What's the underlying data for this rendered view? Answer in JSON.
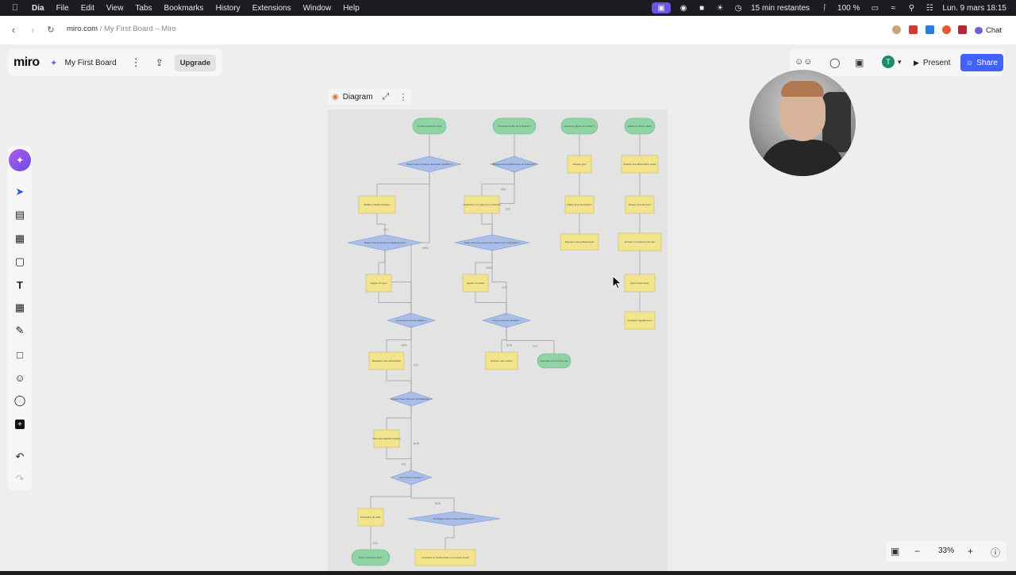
{
  "menubar": {
    "app": "Dia",
    "items": [
      "File",
      "Edit",
      "View",
      "Tabs",
      "Bookmarks",
      "History",
      "Extensions",
      "Window",
      "Help"
    ],
    "timer": "15 min restantes",
    "battery": "100 %",
    "datetime": "Lun. 9 mars  18:15"
  },
  "browser": {
    "url_domain": "miro.com",
    "url_path": " / My First Board – Miro",
    "chat_label": "Chat"
  },
  "miro": {
    "logo": "miro",
    "board_name": "My First Board",
    "upgrade_label": "Upgrade",
    "present_label": "Present",
    "share_label": "Share",
    "avatar_initial": "T",
    "diagram_label": "Diagram",
    "zoom": "33%"
  },
  "flowchart": {
    "nodes": [
      {
        "shape": "terminal",
        "text": "Tu veux perdre du poids"
      },
      {
        "shape": "decision",
        "text": "Suivez-vous un régime alimentaire équilibré ?"
      },
      {
        "shape": "process",
        "text": "Établir un déficit calorique"
      },
      {
        "shape": "decision",
        "text": "Faites-vous de l'exercice régulièrement ?"
      },
      {
        "shape": "process",
        "text": "Intégrer du sport"
      },
      {
        "shape": "decision",
        "text": "Les progrès sont-ils visibles ?"
      },
      {
        "shape": "process",
        "text": "Réajustez votre alimentation"
      },
      {
        "shape": "decision",
        "text": "Pouvez-vous maintenir ces habitudes ?"
      },
      {
        "shape": "process",
        "text": "Fixez des objectifs réalistes"
      },
      {
        "shape": "decision",
        "text": "Avez-vous un soutien ?"
      },
      {
        "shape": "process",
        "text": "Demandez de l'aide"
      },
      {
        "shape": "decision",
        "text": "Envisagez-vous un suivi professionnel ?"
      },
      {
        "shape": "terminal",
        "text": "Bravo, continuez ainsi !"
      },
      {
        "shape": "process",
        "text": "Consultez un nutritionniste ou un coach sportif"
      },
      {
        "shape": "terminal",
        "text": "Comment perdre de la graisse ?"
      },
      {
        "shape": "decision",
        "text": "Mangez-vous suffisamment de protéines ?"
      },
      {
        "shape": "process",
        "text": "Augmentez vos apports en protéines"
      },
      {
        "shape": "decision",
        "text": "Faites-vous des séances de cardio et de musculation ?"
      },
      {
        "shape": "process",
        "text": "Ajoutez du cardio"
      },
      {
        "shape": "decision",
        "text": "Voyez-vous des résultats ?"
      },
      {
        "shape": "process",
        "text": "Révisez votre routine"
      },
      {
        "shape": "terminal",
        "text": "Vous êtes sur la bonne voie"
      },
      {
        "shape": "terminal",
        "text": "Comment gagner du muscle ?"
      },
      {
        "shape": "process",
        "text": "Mangez plus"
      },
      {
        "shape": "process",
        "text": "Faites de la musculation"
      },
      {
        "shape": "process",
        "text": "Reposez-vous suffisamment"
      },
      {
        "shape": "terminal",
        "text": "Rester en bonne santé"
      },
      {
        "shape": "process",
        "text": "Adoptez une alimentation variée"
      },
      {
        "shape": "process",
        "text": "Bougez tous les jours"
      },
      {
        "shape": "process",
        "text": "Dormez 7 à 9 heures par nuit"
      },
      {
        "shape": "process",
        "text": "Gérez votre stress"
      },
      {
        "shape": "process",
        "text": "Consultez régulièrement"
      }
    ],
    "edge_labels": [
      "NON",
      "OUI"
    ]
  },
  "icons": {
    "back": "chevron-left-icon",
    "forward": "chevron-right-icon",
    "reload": "reload-icon",
    "present": "play-icon",
    "share": "user-plus-icon"
  },
  "colors": {
    "terminal_fill": "#8fd3a4",
    "process_fill": "#f2e38d",
    "decision_fill": "#a8bde8",
    "share_blue": "#4262ff",
    "menubar_accent": "#6b55e6"
  }
}
